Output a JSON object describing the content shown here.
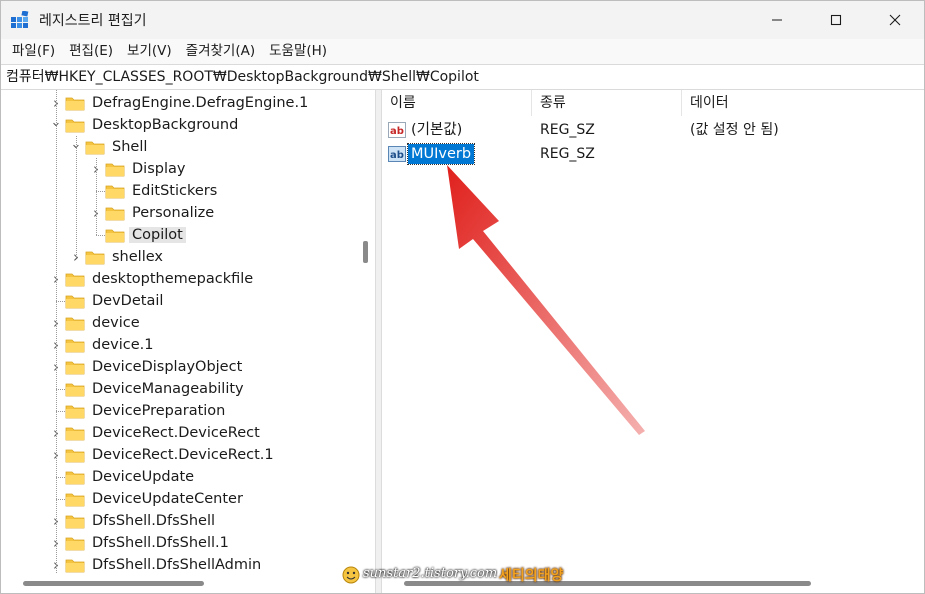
{
  "window": {
    "title": "레지스트리 편집기",
    "colors": {
      "accent": "#0078d4",
      "folder": "#f5c542",
      "arrow": "#e0201c"
    }
  },
  "menu": [
    "파일(F)",
    "편집(E)",
    "보기(V)",
    "즐겨찾기(A)",
    "도움말(H)"
  ],
  "address": "컴퓨터₩HKEY_CLASSES_ROOT₩DesktopBackground₩Shell₩Copilot",
  "tree": [
    {
      "label": "DefragEngine.DefragEngine.1",
      "expand": "collapsed"
    },
    {
      "label": "DesktopBackground",
      "expand": "expanded"
    },
    {
      "label": "Shell",
      "expand": "expanded"
    },
    {
      "label": "Display",
      "expand": "collapsed"
    },
    {
      "label": "EditStickers",
      "expand": "none"
    },
    {
      "label": "Personalize",
      "expand": "collapsed"
    },
    {
      "label": "Copilot",
      "expand": "none",
      "selected": true
    },
    {
      "label": "shellex",
      "expand": "collapsed"
    },
    {
      "label": "desktopthemepackfile",
      "expand": "collapsed"
    },
    {
      "label": "DevDetail",
      "expand": "none"
    },
    {
      "label": "device",
      "expand": "collapsed"
    },
    {
      "label": "device.1",
      "expand": "collapsed"
    },
    {
      "label": "DeviceDisplayObject",
      "expand": "collapsed"
    },
    {
      "label": "DeviceManageability",
      "expand": "none"
    },
    {
      "label": "DevicePreparation",
      "expand": "none"
    },
    {
      "label": "DeviceRect.DeviceRect",
      "expand": "collapsed"
    },
    {
      "label": "DeviceRect.DeviceRect.1",
      "expand": "collapsed"
    },
    {
      "label": "DeviceUpdate",
      "expand": "none"
    },
    {
      "label": "DeviceUpdateCenter",
      "expand": "none"
    },
    {
      "label": "DfsShell.DfsShell",
      "expand": "collapsed"
    },
    {
      "label": "DfsShell.DfsShell.1",
      "expand": "collapsed"
    },
    {
      "label": "DfsShell.DfsShellAdmin",
      "expand": "collapsed"
    }
  ],
  "columns": {
    "name": "이름",
    "type": "종류",
    "data": "데이터"
  },
  "values": [
    {
      "name": "(기본값)",
      "type": "REG_SZ",
      "data": "(값 설정 안 됨)",
      "icon": "string-value-icon"
    },
    {
      "name": "MUIverb",
      "type": "REG_SZ",
      "data": "",
      "icon": "string-value-icon",
      "selected": true
    }
  ],
  "watermark": {
    "site": "sunstar2.tistory.com",
    "brand": "세티의태양"
  }
}
